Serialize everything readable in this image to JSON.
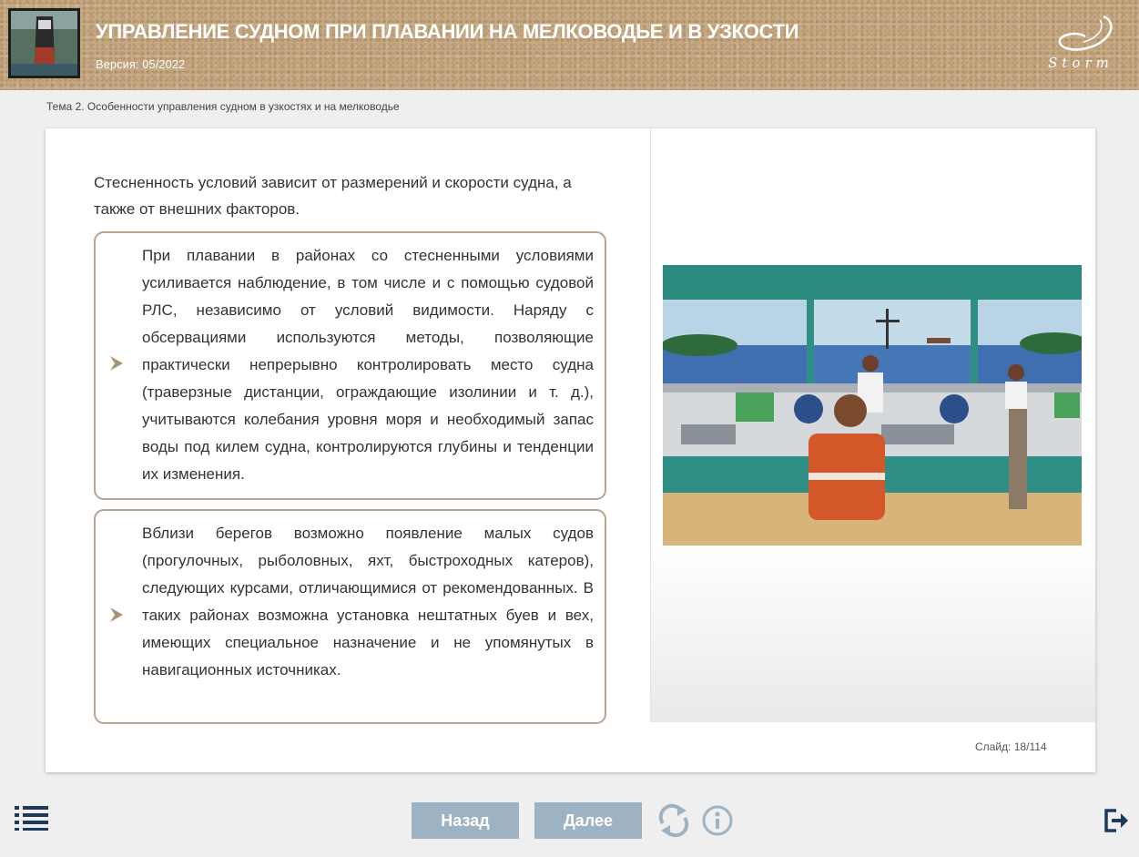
{
  "header": {
    "title": "УПРАВЛЕНИЕ СУДНОМ ПРИ ПЛАВАНИИ НА МЕЛКОВОДЬЕ И В УЗКОСТИ",
    "version": "Версия: 05/2022",
    "logo_text": "Storm"
  },
  "breadcrumb": "Тема 2. Особенности управления судном в узкостях и на мелководье",
  "content": {
    "intro": "Стесненность условий зависит от размерений и скорости судна, а также от внешних факторов.",
    "boxes": [
      {
        "text": "При плавании в районах со стесненными условиями усиливается наблюдение, в том числе и с помощью судовой РЛС, независимо от условий видимости. Наряду с обсервациями используются методы, позволяющие практически непрерывно контролировать место судна (траверзные дистанции, ограждающие изолинии и т. д.), учитываются колебания уровня моря и необходимый запас воды под килем судна, контролируются глубины и тенденции их изменения."
      },
      {
        "text": "Вблизи берегов возможно появление малых судов (прогулочных, рыболовных, яхт, быстроходных катеров), следующих курсами, отличающимися от рекомендованных. В таких районах возможна установка нештатных буев и вех, имеющих специальное назначение и не упомянутых в навигационных источниках."
      }
    ]
  },
  "footer": {
    "slide_label": "Слайд:",
    "slide_current": "18",
    "slide_total": "114",
    "back_label": "Назад",
    "next_label": "Далее"
  },
  "icons": {
    "menu": "menu-list-icon",
    "reload": "reload-icon",
    "info": "info-icon",
    "exit": "exit-icon",
    "bullet": "chevron-right-icon"
  },
  "colors": {
    "header_bg": "#c7a983",
    "button_bg": "#9db2c3",
    "box_border": "#b9a58f",
    "icon_dark": "#1d3a5c",
    "icon_light": "#9db2c3"
  }
}
